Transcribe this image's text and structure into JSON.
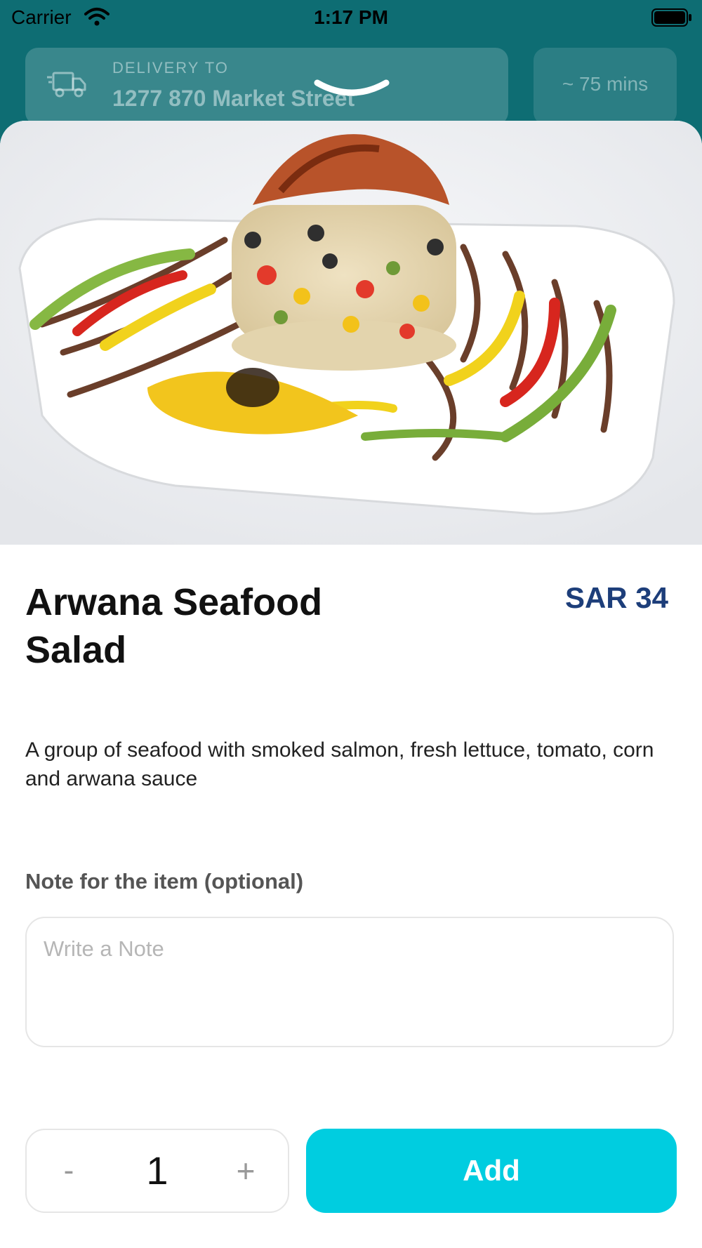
{
  "status_bar": {
    "carrier": "Carrier",
    "time": "1:17 PM"
  },
  "header": {
    "delivery_label": "DELIVERY TO",
    "delivery_address": "1277 870 Market Street",
    "eta": "~ 75 mins"
  },
  "item": {
    "title": "Arwana Seafood Salad",
    "price": "SAR 34",
    "description": "A group of seafood with smoked salmon, fresh lettuce, tomato, corn and arwana sauce"
  },
  "note": {
    "label": "Note for the item (optional)",
    "placeholder": "Write a Note",
    "value": ""
  },
  "quantity": {
    "minus_label": "-",
    "value": "1",
    "plus_label": "+"
  },
  "actions": {
    "add_label": "Add"
  },
  "colors": {
    "header_bg": "#0e6d73",
    "price": "#1d3e7a",
    "add_button": "#00cde0"
  },
  "icons": {
    "wifi": "wifi-icon",
    "battery": "battery-icon",
    "truck": "delivery-truck-icon",
    "dismiss": "chevron-down-icon"
  }
}
